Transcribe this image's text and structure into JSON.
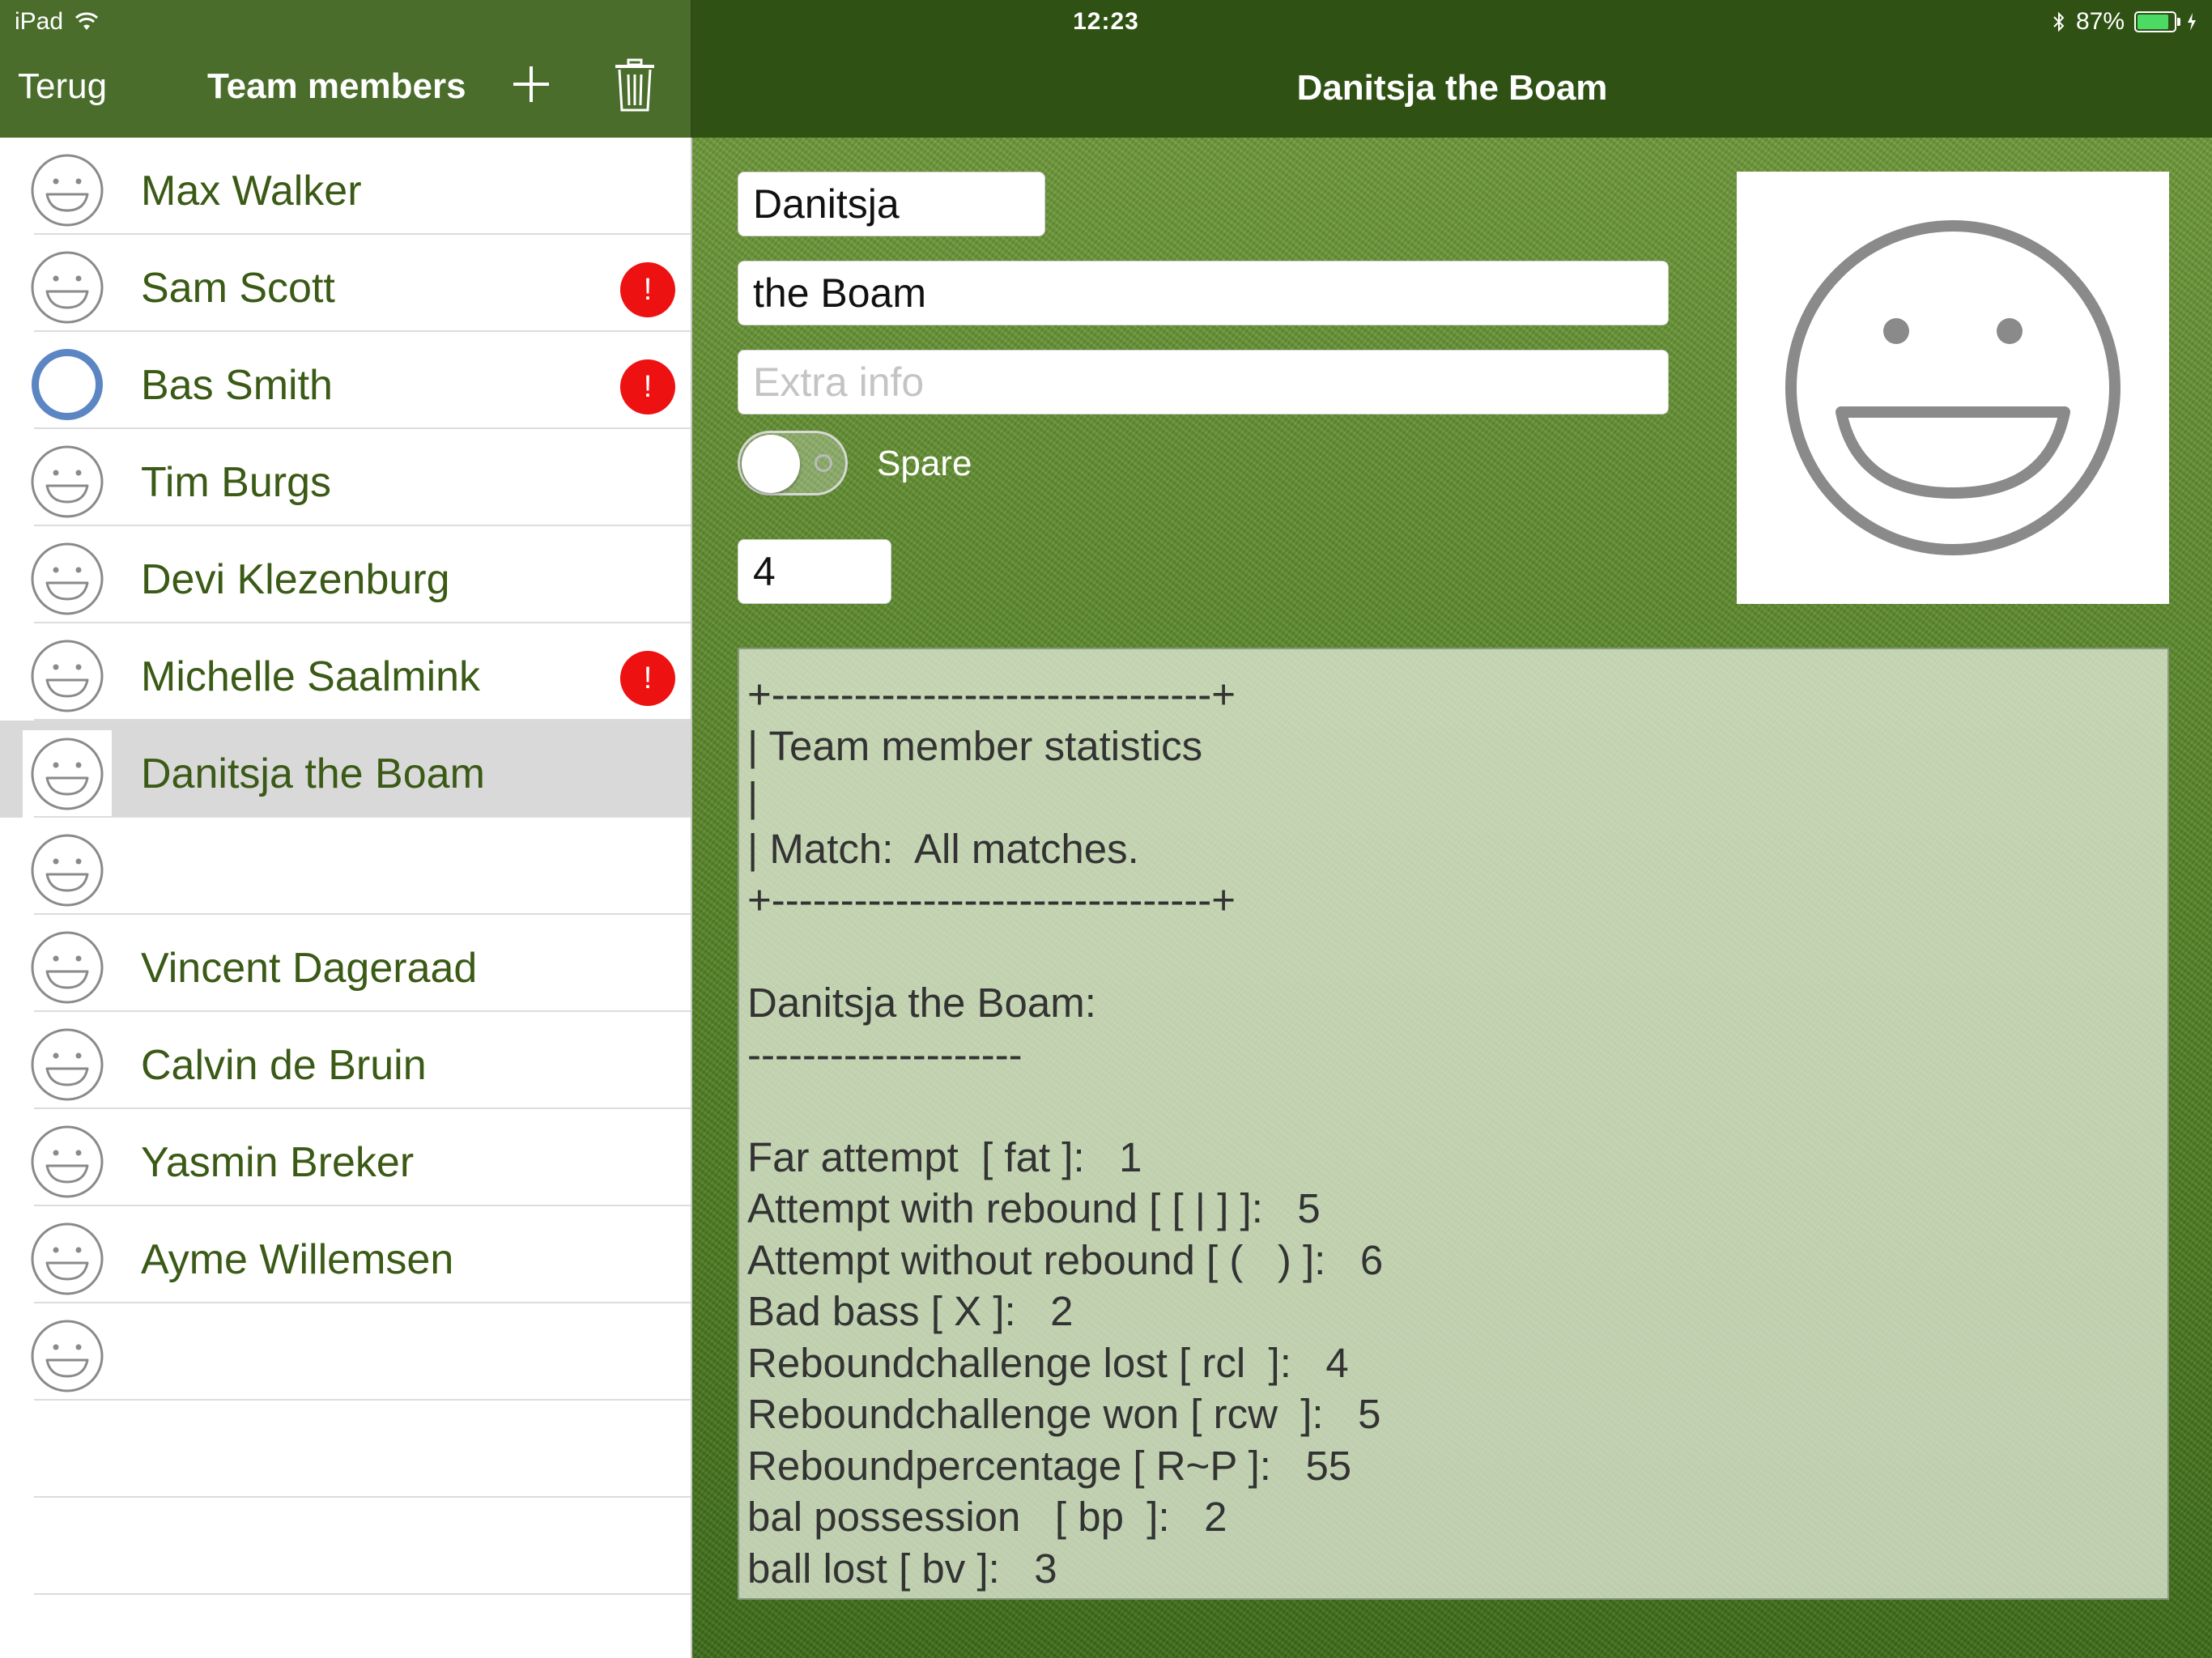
{
  "status_bar": {
    "device": "iPad",
    "time": "12:23",
    "battery": "87%",
    "battery_level": 0.87
  },
  "left_nav": {
    "back_label": "Terug",
    "title": "Team members",
    "add_icon": "plus-icon",
    "delete_icon": "trash-icon"
  },
  "right_nav": {
    "title": "Danitsja the Boam"
  },
  "team_members": [
    {
      "name": "Max Walker",
      "badge": "",
      "avatar": "smiley"
    },
    {
      "name": "Sam Scott",
      "badge": "!",
      "avatar": "smiley"
    },
    {
      "name": "Bas Smith",
      "badge": "!",
      "avatar": "ring"
    },
    {
      "name": "Tim Burgs",
      "badge": "",
      "avatar": "smiley"
    },
    {
      "name": "Devi Klezenburg",
      "badge": "",
      "avatar": "smiley"
    },
    {
      "name": "Michelle Saalmink",
      "badge": "!",
      "avatar": "smiley"
    },
    {
      "name": "Danitsja the Boam",
      "badge": "",
      "avatar": "smiley",
      "selected": true
    },
    {
      "name": "",
      "badge": "",
      "avatar": "smiley"
    },
    {
      "name": "Vincent Dageraad",
      "badge": "",
      "avatar": "smiley"
    },
    {
      "name": "Calvin de Bruin",
      "badge": "",
      "avatar": "smiley"
    },
    {
      "name": "Yasmin Breker",
      "badge": "",
      "avatar": "smiley"
    },
    {
      "name": "Ayme Willemsen",
      "badge": "",
      "avatar": "smiley"
    },
    {
      "name": "",
      "badge": "",
      "avatar": "smiley"
    },
    {
      "name": "",
      "badge": "",
      "avatar": "none"
    },
    {
      "name": "",
      "badge": "",
      "avatar": "none"
    }
  ],
  "detail": {
    "first_name": "Danitsja",
    "last_name": "the Boam",
    "extra_info_placeholder": "Extra info",
    "spare_label": "Spare",
    "spare_on": false,
    "number": "4",
    "photo_icon": "smiley-face-icon",
    "stats_lines": [
      "+--------------------------------+",
      "| Team member statistics",
      "|",
      "| Match:  All matches.",
      "+--------------------------------+",
      "",
      "Danitsja the Boam:",
      "--------------------",
      "",
      "Far attempt  [ fat ]:   1",
      "Attempt with rebound [ [ | ] ]:   5",
      "Attempt without rebound [ (   ) ]:   6",
      "Bad bass [ X ]:   2",
      "Reboundchallenge lost [ rcl  ]:   4",
      "Reboundchallenge won [ rcw  ]:   5",
      "Reboundpercentage [ R~P ]:   55",
      "bal possession   [ bp  ]:   2",
      "ball lost [ bv ]:   3"
    ]
  },
  "colors": {
    "left_nav": "#4a6d2b",
    "right_nav": "#2f5214",
    "name_text": "#3a5a16",
    "badge": "#ee1111",
    "ring": "#5b86c3"
  }
}
